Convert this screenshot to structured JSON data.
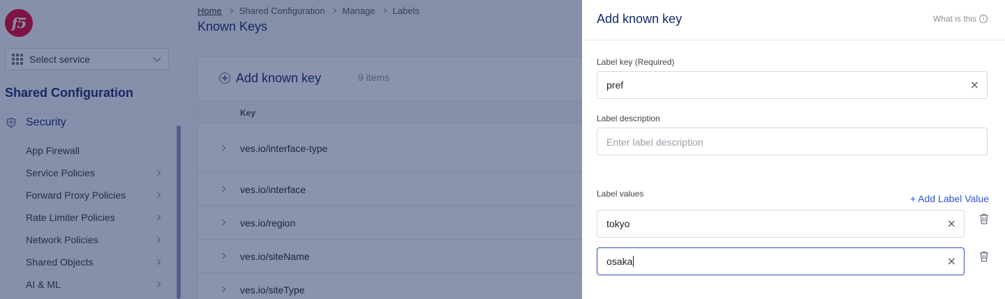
{
  "sidebar": {
    "logo_text": "f5",
    "service_select": "Select service",
    "title": "Shared Configuration",
    "section": "Security",
    "items": [
      {
        "label": "App Firewall",
        "has_arrow": false
      },
      {
        "label": "Service Policies",
        "has_arrow": true
      },
      {
        "label": "Forward Proxy Policies",
        "has_arrow": true
      },
      {
        "label": "Rate Limiter Policies",
        "has_arrow": true
      },
      {
        "label": "Network Policies",
        "has_arrow": true
      },
      {
        "label": "Shared Objects",
        "has_arrow": true
      },
      {
        "label": "AI & ML",
        "has_arrow": true
      }
    ]
  },
  "breadcrumb": [
    "Home",
    "Shared Configuration",
    "Manage",
    "Labels"
  ],
  "page_title": "Known Keys",
  "list": {
    "add_label": "Add known key",
    "count": "9 items",
    "column_key": "Key",
    "rows": [
      "ves.io/interface-type",
      "ves.io/interface",
      "ves.io/region",
      "ves.io/siteName",
      "ves.io/siteType"
    ]
  },
  "drawer": {
    "title": "Add known key",
    "help_link": "What is this",
    "label_key": {
      "label": "Label key (Required)",
      "value": "pref"
    },
    "label_description": {
      "label": "Label description",
      "placeholder": "Enter label description"
    },
    "label_values": {
      "label": "Label values",
      "add_button": "+ Add Label Value",
      "values": [
        "tokyo",
        "osaka"
      ]
    }
  },
  "colors": {
    "brand": "#e4002b",
    "primary_text": "#13286b",
    "link": "#2f55d4",
    "overlay": "#18275c"
  }
}
